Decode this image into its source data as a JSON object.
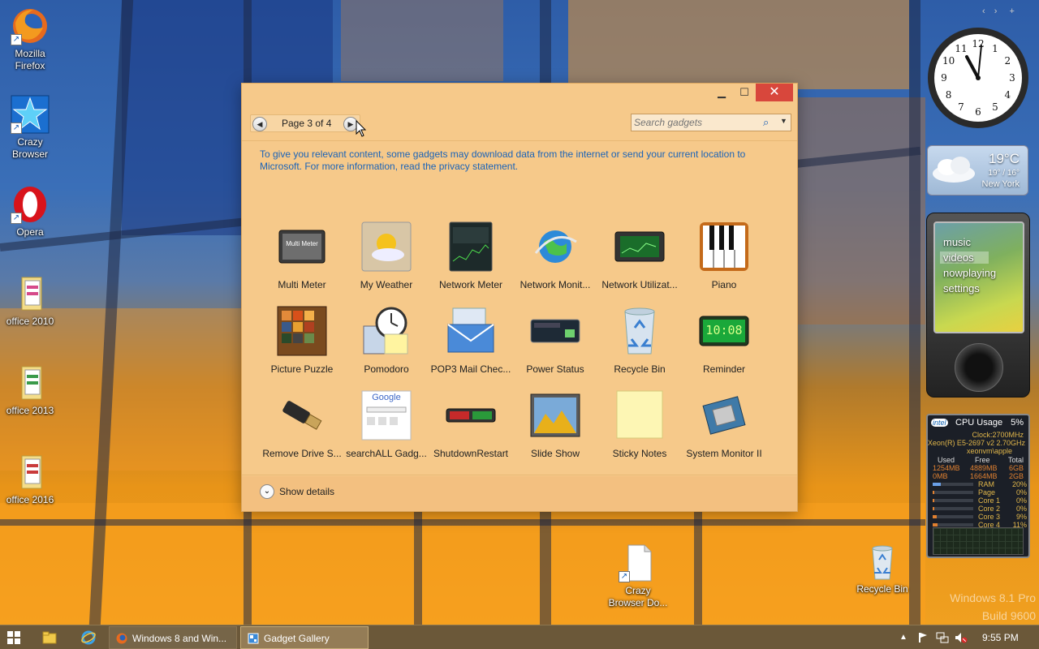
{
  "desktop": {
    "icons": [
      {
        "label_line1": "Mozilla",
        "label_line2": "Firefox"
      },
      {
        "label_line1": "Crazy",
        "label_line2": "Browser"
      },
      {
        "label_line1": "Opera",
        "label_line2": ""
      },
      {
        "label_line1": "office 2010",
        "label_line2": ""
      },
      {
        "label_line1": "office 2013",
        "label_line2": ""
      },
      {
        "label_line1": "office 2016",
        "label_line2": ""
      },
      {
        "label_line1": "Crazy",
        "label_line2": "Browser Do..."
      },
      {
        "label_line1": "Recycle Bin",
        "label_line2": ""
      }
    ],
    "watermark_line1": "Windows 8.1 Pro",
    "watermark_line2": "Build 9600"
  },
  "gallery": {
    "pager_label": "Page 3 of 4",
    "search_placeholder": "Search gadgets",
    "privacy_text": "To give you relevant content, some gadgets may download data from the internet or send your current location to Microsoft. For more information, read the privacy statement.",
    "gadgets": [
      {
        "name": "Multi Meter"
      },
      {
        "name": "My Weather"
      },
      {
        "name": "Network Meter"
      },
      {
        "name": "Network Monit..."
      },
      {
        "name": "Network Utilizat..."
      },
      {
        "name": "Piano"
      },
      {
        "name": "Picture Puzzle"
      },
      {
        "name": "Pomodoro"
      },
      {
        "name": "POP3 Mail Chec..."
      },
      {
        "name": "Power Status"
      },
      {
        "name": "Recycle Bin"
      },
      {
        "name": "Reminder"
      },
      {
        "name": "Remove Drive S..."
      },
      {
        "name": "searchALL Gadg..."
      },
      {
        "name": "ShutdownRestart"
      },
      {
        "name": "Slide Show"
      },
      {
        "name": "Sticky Notes"
      },
      {
        "name": "System Monitor II"
      }
    ],
    "show_details_label": "Show details",
    "thumb_texts": {
      "multi_meter": "Multi Meter",
      "reminder": "10:08",
      "google": "Google"
    }
  },
  "sidebar": {
    "clock_numbers": [
      "12",
      "1",
      "2",
      "3",
      "4",
      "5",
      "6",
      "7",
      "8",
      "9",
      "10",
      "11"
    ],
    "weather": {
      "temp": "19°C",
      "range": "19° / 16°",
      "city": "New York"
    },
    "zune_menu": [
      "music",
      "videos",
      "nowplaying",
      "settings"
    ],
    "cpu": {
      "title": "CPU Usage",
      "percent": "5%",
      "brand": "intel",
      "clock": "Clock:2700MHz",
      "model": "Xeon(R) E5-2697 v2 2.70GHz",
      "host": "xeonvm\\apple",
      "headers": [
        "Used",
        "Free",
        "Total"
      ],
      "ram_row": [
        "1254MB",
        "4889MB",
        "6GB"
      ],
      "page_row": [
        "0MB",
        "1664MB",
        "2GB"
      ],
      "meters": [
        {
          "label": "RAM",
          "value": "20%"
        },
        {
          "label": "Page",
          "value": "0%"
        },
        {
          "label": "Core 1",
          "value": "0%"
        },
        {
          "label": "Core 2",
          "value": "0%"
        },
        {
          "label": "Core 3",
          "value": "9%"
        },
        {
          "label": "Core 4",
          "value": "11%"
        }
      ]
    }
  },
  "taskbar": {
    "tasks": [
      {
        "label": "Windows 8 and Win..."
      },
      {
        "label": "Gadget Gallery"
      }
    ],
    "time": "9:55 PM"
  }
}
